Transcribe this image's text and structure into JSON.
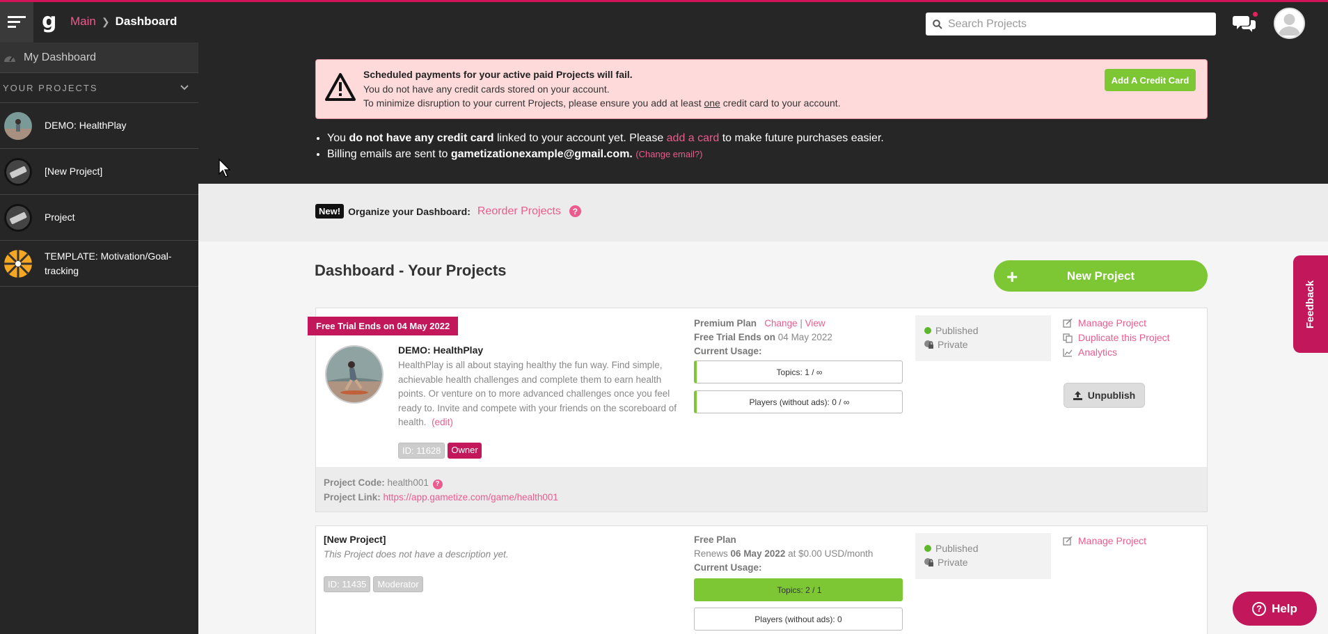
{
  "topbar": {
    "breadcrumb_main": "Main",
    "breadcrumb_current": "Dashboard",
    "search_placeholder": "Search Projects",
    "logo_letter": "g"
  },
  "sidebar": {
    "dashboard_label": "My Dashboard",
    "projects_header": "YOUR PROJECTS",
    "items": [
      {
        "label": "DEMO: HealthPlay"
      },
      {
        "label": "[New Project]"
      },
      {
        "label": "Project"
      },
      {
        "label": "TEMPLATE: Motivation/Goal-tracking"
      }
    ]
  },
  "alert": {
    "title": "Scheduled payments for your active paid Projects will fail.",
    "line1": "You do not have any credit cards stored on your account.",
    "line2_pre": "To minimize disruption to your current Projects, please ensure you add at least ",
    "line2_u": "one",
    "line2_post": " credit card to your account.",
    "button": "Add A Credit Card"
  },
  "billing": {
    "li1_a": "You ",
    "li1_b": "do not have any credit card",
    "li1_c": " linked to your account yet. Please ",
    "li1_link": "add a card",
    "li1_d": " to make future purchases easier.",
    "li2_a": "Billing emails are sent to ",
    "li2_email": "gametizationexample@gmail.com",
    "li2_dot": ".",
    "li2_link": "(Change email?)"
  },
  "reorder": {
    "new_tag": "New!",
    "label": "Organize your Dashboard:",
    "link": "Reorder Projects",
    "help": "?"
  },
  "main": {
    "title": "Dashboard - Your Projects",
    "new_project_button": "New Project"
  },
  "projects": [
    {
      "ribbon": "Free Trial Ends on 04 May 2022",
      "name": "DEMO: HealthPlay",
      "description": "HealthPlay is all about staying healthy the fun way. Find simple, achievable health challenges and complete them to earn health points. Or venture on to more advanced challenges once you feel ready to. Invite and compete with your friends on the scoreboard of health.",
      "edit": "(edit)",
      "id_tag": "ID: 11628",
      "role": "Owner",
      "plan_name": "Premium Plan",
      "plan_change": "Change",
      "plan_sep": "|",
      "plan_view": "View",
      "plan_line2_label": "Free Trial Ends on",
      "plan_line2_value": "04 May 2022",
      "usage_label": "Current Usage:",
      "usage_topics": "Topics: 1 / ∞",
      "usage_players": "Players (without ads): 0 / ∞",
      "status_published": "Published",
      "status_private": "Private",
      "action_manage": "Manage Project",
      "action_duplicate": "Duplicate this Project",
      "action_analytics": "Analytics",
      "unpublish": "Unpublish",
      "code_label": "Project Code:",
      "code_value": "health001",
      "link_label": "Project Link:",
      "link_value": "https://app.gametize.com/game/health001"
    },
    {
      "name": "[New Project]",
      "description": "This Project does not have a description yet.",
      "id_tag": "ID: 11435",
      "role": "Moderator",
      "plan_name": "Free Plan",
      "plan_line2_pre": "Renews",
      "plan_line2_date": "06 May 2022",
      "plan_line2_post": "at $0.00 USD/month",
      "usage_label": "Current Usage:",
      "usage_topics": "Topics: 2 / 1",
      "usage_players": "Players (without ads): 0",
      "status_published": "Published",
      "status_private": "Private",
      "action_manage": "Manage Project"
    }
  ],
  "feedback": "Feedback",
  "help": "Help",
  "colors": {
    "accent_pink": "#ec5b8e",
    "brand_magenta": "#c2185b",
    "green": "#7dc734",
    "dark": "#262626"
  }
}
